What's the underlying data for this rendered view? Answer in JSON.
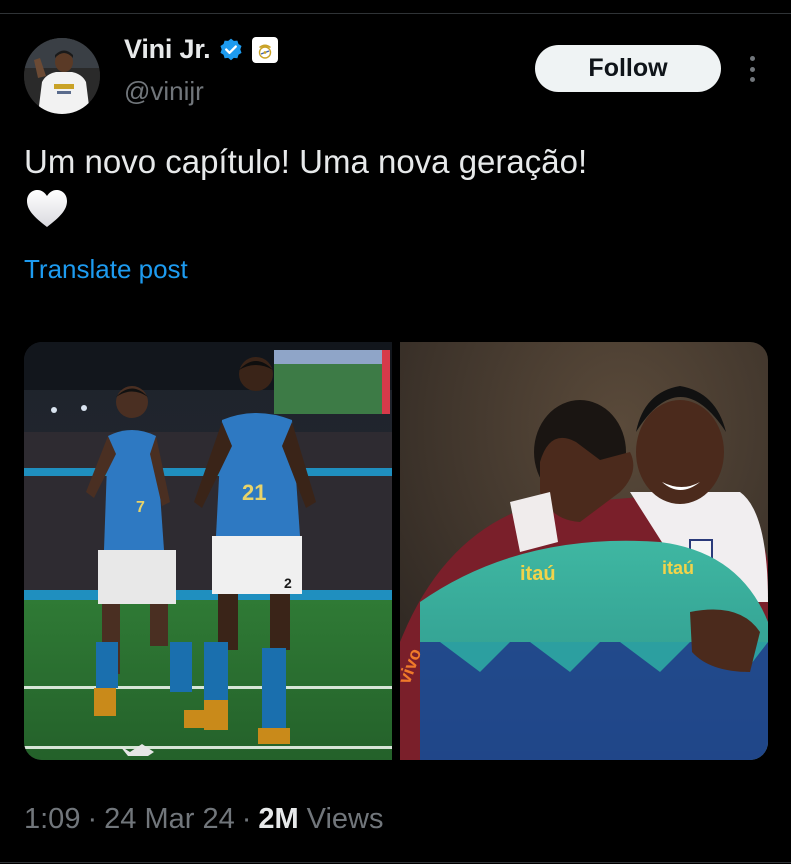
{
  "author": {
    "display_name": "Vini Jr.",
    "handle": "@vinijr",
    "verified_icon": "verified-badge-icon",
    "affiliate_badge_icon": "real-madrid-crest-icon",
    "verified_color": "#1d9bf0"
  },
  "follow_label": "Follow",
  "post": {
    "text": "Um novo capítulo!  Uma nova geração!",
    "emoji_icon": "white-heart-icon",
    "translate_label": "Translate post"
  },
  "media": [
    {
      "name": "photo-brazil-players-celebrating"
    },
    {
      "name": "photo-players-embracing"
    }
  ],
  "meta": {
    "time": "1:09",
    "date": "24 Mar 24",
    "views_count": "2M",
    "views_label": "Views",
    "separator": "·"
  },
  "colors": {
    "background": "#000000",
    "text_primary": "#e7e9ea",
    "text_secondary": "#71767b",
    "link": "#1d9bf0",
    "follow_bg": "#eff3f4"
  }
}
